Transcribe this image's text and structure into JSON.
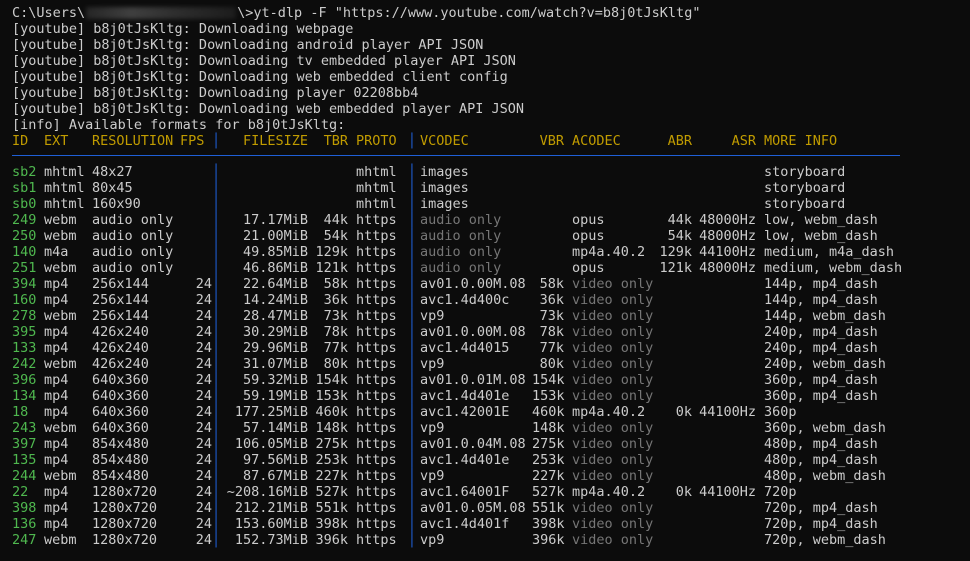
{
  "prompt": {
    "path_start": "C:\\Users\\",
    "path_end": "\\>",
    "command": "yt-dlp -F \"https://www.youtube.com/watch?v=b8j0tJsKltg\""
  },
  "log_lines": [
    "[youtube] b8j0tJsKltg: Downloading webpage",
    "[youtube] b8j0tJsKltg: Downloading android player API JSON",
    "[youtube] b8j0tJsKltg: Downloading tv embedded player API JSON",
    "[youtube] b8j0tJsKltg: Downloading web embedded client config",
    "[youtube] b8j0tJsKltg: Downloading player 02208bb4",
    "[youtube] b8j0tJsKltg: Downloading web embedded player API JSON",
    "[info] Available formats for b8j0tJsKltg:"
  ],
  "headers": {
    "id": "ID",
    "ext": "EXT",
    "resolution": "RESOLUTION",
    "fps": "FPS",
    "filesize": "FILESIZE",
    "tbr": "TBR",
    "proto": "PROTO",
    "vcodec": "VCODEC",
    "vbr": "VBR",
    "acodec": "ACODEC",
    "abr": "ABR",
    "asr": "ASR",
    "more_info": "MORE INFO"
  },
  "separator": "│",
  "colors": {
    "header": "#c19c00",
    "id": "#4fb84f",
    "separator": "#1f5fd6",
    "dim": "#767676",
    "text": "#cccccc",
    "background": "#0c0c0c"
  },
  "formats": [
    {
      "id": "sb2",
      "ext": "mhtml",
      "res": "48x27",
      "fps": "",
      "size": "",
      "tbr": "",
      "proto": "mhtml",
      "vcodec": "images",
      "vdim": false,
      "vbr": "",
      "acodec": "",
      "adim": false,
      "abr": "",
      "asr": "",
      "more": "storyboard"
    },
    {
      "id": "sb1",
      "ext": "mhtml",
      "res": "80x45",
      "fps": "",
      "size": "",
      "tbr": "",
      "proto": "mhtml",
      "vcodec": "images",
      "vdim": false,
      "vbr": "",
      "acodec": "",
      "adim": false,
      "abr": "",
      "asr": "",
      "more": "storyboard"
    },
    {
      "id": "sb0",
      "ext": "mhtml",
      "res": "160x90",
      "fps": "",
      "size": "",
      "tbr": "",
      "proto": "mhtml",
      "vcodec": "images",
      "vdim": false,
      "vbr": "",
      "acodec": "",
      "adim": false,
      "abr": "",
      "asr": "",
      "more": "storyboard"
    },
    {
      "id": "249",
      "ext": "webm",
      "res": "audio only",
      "fps": "",
      "size": "17.17MiB",
      "tbr": "44k",
      "proto": "https",
      "vcodec": "audio only",
      "vdim": true,
      "vbr": "",
      "acodec": "opus",
      "adim": false,
      "abr": "44k",
      "asr": "48000Hz",
      "more": "low, webm_dash"
    },
    {
      "id": "250",
      "ext": "webm",
      "res": "audio only",
      "fps": "",
      "size": "21.00MiB",
      "tbr": "54k",
      "proto": "https",
      "vcodec": "audio only",
      "vdim": true,
      "vbr": "",
      "acodec": "opus",
      "adim": false,
      "abr": "54k",
      "asr": "48000Hz",
      "more": "low, webm_dash"
    },
    {
      "id": "140",
      "ext": "m4a",
      "res": "audio only",
      "fps": "",
      "size": "49.85MiB",
      "tbr": "129k",
      "proto": "https",
      "vcodec": "audio only",
      "vdim": true,
      "vbr": "",
      "acodec": "mp4a.40.2",
      "adim": false,
      "abr": "129k",
      "asr": "44100Hz",
      "more": "medium, m4a_dash"
    },
    {
      "id": "251",
      "ext": "webm",
      "res": "audio only",
      "fps": "",
      "size": "46.86MiB",
      "tbr": "121k",
      "proto": "https",
      "vcodec": "audio only",
      "vdim": true,
      "vbr": "",
      "acodec": "opus",
      "adim": false,
      "abr": "121k",
      "asr": "48000Hz",
      "more": "medium, webm_dash"
    },
    {
      "id": "394",
      "ext": "mp4",
      "res": "256x144",
      "fps": "24",
      "size": "22.64MiB",
      "tbr": "58k",
      "proto": "https",
      "vcodec": "av01.0.00M.08",
      "vdim": false,
      "vbr": "58k",
      "acodec": "video only",
      "adim": true,
      "abr": "",
      "asr": "",
      "more": "144p, mp4_dash"
    },
    {
      "id": "160",
      "ext": "mp4",
      "res": "256x144",
      "fps": "24",
      "size": "14.24MiB",
      "tbr": "36k",
      "proto": "https",
      "vcodec": "avc1.4d400c",
      "vdim": false,
      "vbr": "36k",
      "acodec": "video only",
      "adim": true,
      "abr": "",
      "asr": "",
      "more": "144p, mp4_dash"
    },
    {
      "id": "278",
      "ext": "webm",
      "res": "256x144",
      "fps": "24",
      "size": "28.47MiB",
      "tbr": "73k",
      "proto": "https",
      "vcodec": "vp9",
      "vdim": false,
      "vbr": "73k",
      "acodec": "video only",
      "adim": true,
      "abr": "",
      "asr": "",
      "more": "144p, webm_dash"
    },
    {
      "id": "395",
      "ext": "mp4",
      "res": "426x240",
      "fps": "24",
      "size": "30.29MiB",
      "tbr": "78k",
      "proto": "https",
      "vcodec": "av01.0.00M.08",
      "vdim": false,
      "vbr": "78k",
      "acodec": "video only",
      "adim": true,
      "abr": "",
      "asr": "",
      "more": "240p, mp4_dash"
    },
    {
      "id": "133",
      "ext": "mp4",
      "res": "426x240",
      "fps": "24",
      "size": "29.96MiB",
      "tbr": "77k",
      "proto": "https",
      "vcodec": "avc1.4d4015",
      "vdim": false,
      "vbr": "77k",
      "acodec": "video only",
      "adim": true,
      "abr": "",
      "asr": "",
      "more": "240p, mp4_dash"
    },
    {
      "id": "242",
      "ext": "webm",
      "res": "426x240",
      "fps": "24",
      "size": "31.07MiB",
      "tbr": "80k",
      "proto": "https",
      "vcodec": "vp9",
      "vdim": false,
      "vbr": "80k",
      "acodec": "video only",
      "adim": true,
      "abr": "",
      "asr": "",
      "more": "240p, webm_dash"
    },
    {
      "id": "396",
      "ext": "mp4",
      "res": "640x360",
      "fps": "24",
      "size": "59.32MiB",
      "tbr": "154k",
      "proto": "https",
      "vcodec": "av01.0.01M.08",
      "vdim": false,
      "vbr": "154k",
      "acodec": "video only",
      "adim": true,
      "abr": "",
      "asr": "",
      "more": "360p, mp4_dash"
    },
    {
      "id": "134",
      "ext": "mp4",
      "res": "640x360",
      "fps": "24",
      "size": "59.19MiB",
      "tbr": "153k",
      "proto": "https",
      "vcodec": "avc1.4d401e",
      "vdim": false,
      "vbr": "153k",
      "acodec": "video only",
      "adim": true,
      "abr": "",
      "asr": "",
      "more": "360p, mp4_dash"
    },
    {
      "id": "18",
      "ext": "mp4",
      "res": "640x360",
      "fps": "24",
      "size": "177.25MiB",
      "tbr": "460k",
      "proto": "https",
      "vcodec": "avc1.42001E",
      "vdim": false,
      "vbr": "460k",
      "acodec": "mp4a.40.2",
      "adim": false,
      "abr": "0k",
      "asr": "44100Hz",
      "more": "360p"
    },
    {
      "id": "243",
      "ext": "webm",
      "res": "640x360",
      "fps": "24",
      "size": "57.14MiB",
      "tbr": "148k",
      "proto": "https",
      "vcodec": "vp9",
      "vdim": false,
      "vbr": "148k",
      "acodec": "video only",
      "adim": true,
      "abr": "",
      "asr": "",
      "more": "360p, webm_dash"
    },
    {
      "id": "397",
      "ext": "mp4",
      "res": "854x480",
      "fps": "24",
      "size": "106.05MiB",
      "tbr": "275k",
      "proto": "https",
      "vcodec": "av01.0.04M.08",
      "vdim": false,
      "vbr": "275k",
      "acodec": "video only",
      "adim": true,
      "abr": "",
      "asr": "",
      "more": "480p, mp4_dash"
    },
    {
      "id": "135",
      "ext": "mp4",
      "res": "854x480",
      "fps": "24",
      "size": "97.56MiB",
      "tbr": "253k",
      "proto": "https",
      "vcodec": "avc1.4d401e",
      "vdim": false,
      "vbr": "253k",
      "acodec": "video only",
      "adim": true,
      "abr": "",
      "asr": "",
      "more": "480p, mp4_dash"
    },
    {
      "id": "244",
      "ext": "webm",
      "res": "854x480",
      "fps": "24",
      "size": "87.67MiB",
      "tbr": "227k",
      "proto": "https",
      "vcodec": "vp9",
      "vdim": false,
      "vbr": "227k",
      "acodec": "video only",
      "adim": true,
      "abr": "",
      "asr": "",
      "more": "480p, webm_dash"
    },
    {
      "id": "22",
      "ext": "mp4",
      "res": "1280x720",
      "fps": "24",
      "size": "~208.16MiB",
      "tbr": "527k",
      "proto": "https",
      "vcodec": "avc1.64001F",
      "vdim": false,
      "vbr": "527k",
      "acodec": "mp4a.40.2",
      "adim": false,
      "abr": "0k",
      "asr": "44100Hz",
      "more": "720p"
    },
    {
      "id": "398",
      "ext": "mp4",
      "res": "1280x720",
      "fps": "24",
      "size": "212.21MiB",
      "tbr": "551k",
      "proto": "https",
      "vcodec": "av01.0.05M.08",
      "vdim": false,
      "vbr": "551k",
      "acodec": "video only",
      "adim": true,
      "abr": "",
      "asr": "",
      "more": "720p, mp4_dash"
    },
    {
      "id": "136",
      "ext": "mp4",
      "res": "1280x720",
      "fps": "24",
      "size": "153.60MiB",
      "tbr": "398k",
      "proto": "https",
      "vcodec": "avc1.4d401f",
      "vdim": false,
      "vbr": "398k",
      "acodec": "video only",
      "adim": true,
      "abr": "",
      "asr": "",
      "more": "720p, mp4_dash"
    },
    {
      "id": "247",
      "ext": "webm",
      "res": "1280x720",
      "fps": "24",
      "size": "152.73MiB",
      "tbr": "396k",
      "proto": "https",
      "vcodec": "vp9",
      "vdim": false,
      "vbr": "396k",
      "acodec": "video only",
      "adim": true,
      "abr": "",
      "asr": "",
      "more": "720p, webm_dash"
    }
  ]
}
